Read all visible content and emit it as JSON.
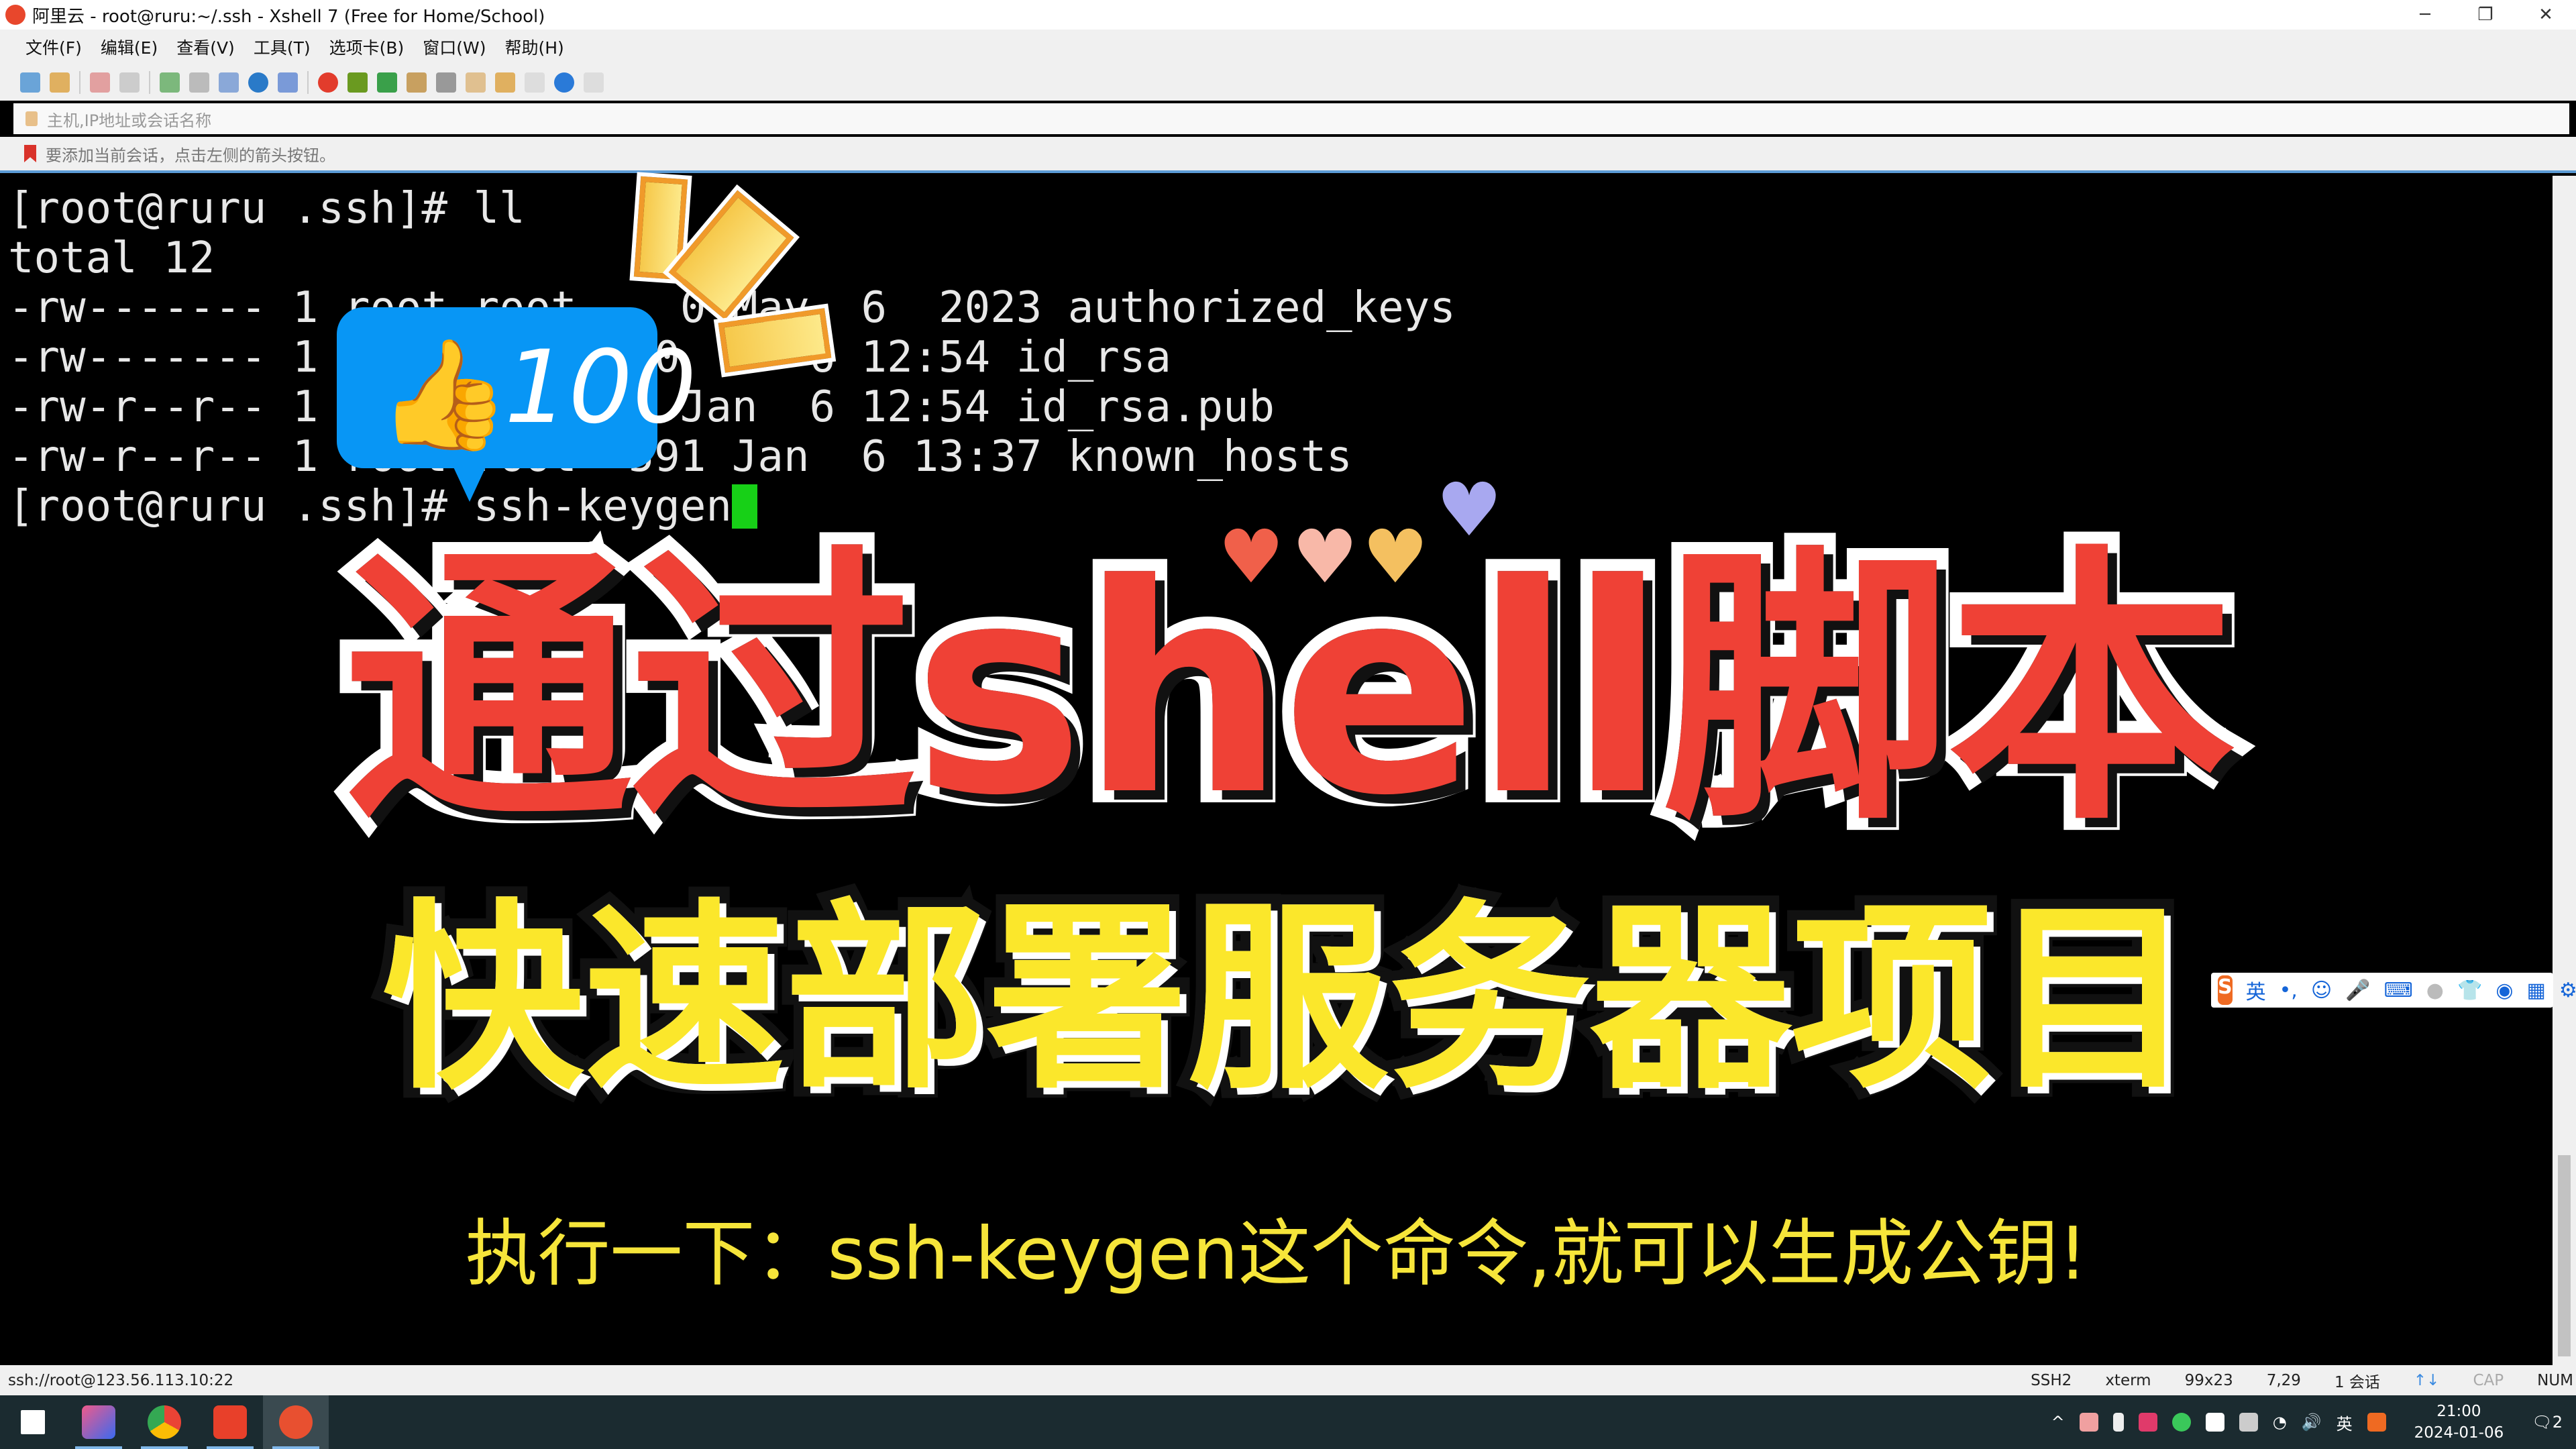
{
  "window": {
    "title": "阿里云 - root@ruru:~/.ssh - Xshell 7 (Free for Home/School)",
    "minimize": "─",
    "restore": "❐",
    "close": "✕"
  },
  "menu": [
    "文件(F)",
    "编辑(E)",
    "查看(V)",
    "工具(T)",
    "选项卡(B)",
    "窗口(W)",
    "帮助(H)"
  ],
  "address": {
    "placeholder": "主机,IP地址或会话名称"
  },
  "hint": "要添加当前会话，点击左侧的箭头按钮。",
  "terminal": {
    "lines": [
      "[root@ruru .ssh]# ll",
      "total 12",
      "-rw------- 1 root root    0 May  6  2023 authorized_keys",
      "-rw------- 1            00     6 12:54 id_rsa",
      "-rw-r--r-- 1            3 Jan  6 12:54 id_rsa.pub",
      "-rw-r--r-- 1 root root  591 Jan  6 13:37 known_hosts"
    ],
    "prompt": "[root@ruru .ssh]# ",
    "command": "ssh-keygen",
    "cursor_color": "#17d017"
  },
  "overlay": {
    "title": "通过shell脚本",
    "subtitle": "快速部署服务器项目",
    "caption": "执行一下：ssh-keygen这个命令,就可以生成公钥!",
    "sticker_count": "100",
    "colors": {
      "title": "#ef4136",
      "subtitle": "#fbe72b",
      "caption": "#f6e53a",
      "sticker": "#0896f5"
    }
  },
  "ime_toolbar": {
    "s": "S",
    "lang": "英",
    "punct": "•,"
  },
  "status": {
    "connection": "ssh://root@123.56.113.10:22",
    "protocol": "SSH2",
    "term": "xterm",
    "size": "99x23",
    "cursor": "7,29",
    "sessions": "1 会话",
    "cap": "CAP",
    "num": "NUM"
  },
  "taskbar": {
    "ime": "英",
    "time": "21:00",
    "date": "2024-01-06",
    "notifications": "2"
  }
}
